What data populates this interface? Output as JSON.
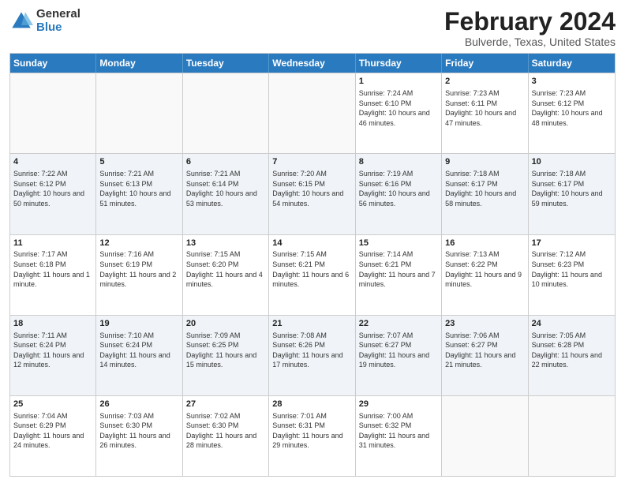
{
  "header": {
    "logo_general": "General",
    "logo_blue": "Blue",
    "title": "February 2024",
    "subtitle": "Bulverde, Texas, United States"
  },
  "days": [
    "Sunday",
    "Monday",
    "Tuesday",
    "Wednesday",
    "Thursday",
    "Friday",
    "Saturday"
  ],
  "rows": [
    [
      {
        "day": "",
        "sunrise": "",
        "sunset": "",
        "daylight": "",
        "empty": true
      },
      {
        "day": "",
        "sunrise": "",
        "sunset": "",
        "daylight": "",
        "empty": true
      },
      {
        "day": "",
        "sunrise": "",
        "sunset": "",
        "daylight": "",
        "empty": true
      },
      {
        "day": "",
        "sunrise": "",
        "sunset": "",
        "daylight": "",
        "empty": true
      },
      {
        "day": "1",
        "sunrise": "Sunrise: 7:24 AM",
        "sunset": "Sunset: 6:10 PM",
        "daylight": "Daylight: 10 hours and 46 minutes.",
        "empty": false
      },
      {
        "day": "2",
        "sunrise": "Sunrise: 7:23 AM",
        "sunset": "Sunset: 6:11 PM",
        "daylight": "Daylight: 10 hours and 47 minutes.",
        "empty": false
      },
      {
        "day": "3",
        "sunrise": "Sunrise: 7:23 AM",
        "sunset": "Sunset: 6:12 PM",
        "daylight": "Daylight: 10 hours and 48 minutes.",
        "empty": false
      }
    ],
    [
      {
        "day": "4",
        "sunrise": "Sunrise: 7:22 AM",
        "sunset": "Sunset: 6:12 PM",
        "daylight": "Daylight: 10 hours and 50 minutes.",
        "empty": false
      },
      {
        "day": "5",
        "sunrise": "Sunrise: 7:21 AM",
        "sunset": "Sunset: 6:13 PM",
        "daylight": "Daylight: 10 hours and 51 minutes.",
        "empty": false
      },
      {
        "day": "6",
        "sunrise": "Sunrise: 7:21 AM",
        "sunset": "Sunset: 6:14 PM",
        "daylight": "Daylight: 10 hours and 53 minutes.",
        "empty": false
      },
      {
        "day": "7",
        "sunrise": "Sunrise: 7:20 AM",
        "sunset": "Sunset: 6:15 PM",
        "daylight": "Daylight: 10 hours and 54 minutes.",
        "empty": false
      },
      {
        "day": "8",
        "sunrise": "Sunrise: 7:19 AM",
        "sunset": "Sunset: 6:16 PM",
        "daylight": "Daylight: 10 hours and 56 minutes.",
        "empty": false
      },
      {
        "day": "9",
        "sunrise": "Sunrise: 7:18 AM",
        "sunset": "Sunset: 6:17 PM",
        "daylight": "Daylight: 10 hours and 58 minutes.",
        "empty": false
      },
      {
        "day": "10",
        "sunrise": "Sunrise: 7:18 AM",
        "sunset": "Sunset: 6:17 PM",
        "daylight": "Daylight: 10 hours and 59 minutes.",
        "empty": false
      }
    ],
    [
      {
        "day": "11",
        "sunrise": "Sunrise: 7:17 AM",
        "sunset": "Sunset: 6:18 PM",
        "daylight": "Daylight: 11 hours and 1 minute.",
        "empty": false
      },
      {
        "day": "12",
        "sunrise": "Sunrise: 7:16 AM",
        "sunset": "Sunset: 6:19 PM",
        "daylight": "Daylight: 11 hours and 2 minutes.",
        "empty": false
      },
      {
        "day": "13",
        "sunrise": "Sunrise: 7:15 AM",
        "sunset": "Sunset: 6:20 PM",
        "daylight": "Daylight: 11 hours and 4 minutes.",
        "empty": false
      },
      {
        "day": "14",
        "sunrise": "Sunrise: 7:15 AM",
        "sunset": "Sunset: 6:21 PM",
        "daylight": "Daylight: 11 hours and 6 minutes.",
        "empty": false
      },
      {
        "day": "15",
        "sunrise": "Sunrise: 7:14 AM",
        "sunset": "Sunset: 6:21 PM",
        "daylight": "Daylight: 11 hours and 7 minutes.",
        "empty": false
      },
      {
        "day": "16",
        "sunrise": "Sunrise: 7:13 AM",
        "sunset": "Sunset: 6:22 PM",
        "daylight": "Daylight: 11 hours and 9 minutes.",
        "empty": false
      },
      {
        "day": "17",
        "sunrise": "Sunrise: 7:12 AM",
        "sunset": "Sunset: 6:23 PM",
        "daylight": "Daylight: 11 hours and 10 minutes.",
        "empty": false
      }
    ],
    [
      {
        "day": "18",
        "sunrise": "Sunrise: 7:11 AM",
        "sunset": "Sunset: 6:24 PM",
        "daylight": "Daylight: 11 hours and 12 minutes.",
        "empty": false
      },
      {
        "day": "19",
        "sunrise": "Sunrise: 7:10 AM",
        "sunset": "Sunset: 6:24 PM",
        "daylight": "Daylight: 11 hours and 14 minutes.",
        "empty": false
      },
      {
        "day": "20",
        "sunrise": "Sunrise: 7:09 AM",
        "sunset": "Sunset: 6:25 PM",
        "daylight": "Daylight: 11 hours and 15 minutes.",
        "empty": false
      },
      {
        "day": "21",
        "sunrise": "Sunrise: 7:08 AM",
        "sunset": "Sunset: 6:26 PM",
        "daylight": "Daylight: 11 hours and 17 minutes.",
        "empty": false
      },
      {
        "day": "22",
        "sunrise": "Sunrise: 7:07 AM",
        "sunset": "Sunset: 6:27 PM",
        "daylight": "Daylight: 11 hours and 19 minutes.",
        "empty": false
      },
      {
        "day": "23",
        "sunrise": "Sunrise: 7:06 AM",
        "sunset": "Sunset: 6:27 PM",
        "daylight": "Daylight: 11 hours and 21 minutes.",
        "empty": false
      },
      {
        "day": "24",
        "sunrise": "Sunrise: 7:05 AM",
        "sunset": "Sunset: 6:28 PM",
        "daylight": "Daylight: 11 hours and 22 minutes.",
        "empty": false
      }
    ],
    [
      {
        "day": "25",
        "sunrise": "Sunrise: 7:04 AM",
        "sunset": "Sunset: 6:29 PM",
        "daylight": "Daylight: 11 hours and 24 minutes.",
        "empty": false
      },
      {
        "day": "26",
        "sunrise": "Sunrise: 7:03 AM",
        "sunset": "Sunset: 6:30 PM",
        "daylight": "Daylight: 11 hours and 26 minutes.",
        "empty": false
      },
      {
        "day": "27",
        "sunrise": "Sunrise: 7:02 AM",
        "sunset": "Sunset: 6:30 PM",
        "daylight": "Daylight: 11 hours and 28 minutes.",
        "empty": false
      },
      {
        "day": "28",
        "sunrise": "Sunrise: 7:01 AM",
        "sunset": "Sunset: 6:31 PM",
        "daylight": "Daylight: 11 hours and 29 minutes.",
        "empty": false
      },
      {
        "day": "29",
        "sunrise": "Sunrise: 7:00 AM",
        "sunset": "Sunset: 6:32 PM",
        "daylight": "Daylight: 11 hours and 31 minutes.",
        "empty": false
      },
      {
        "day": "",
        "sunrise": "",
        "sunset": "",
        "daylight": "",
        "empty": true
      },
      {
        "day": "",
        "sunrise": "",
        "sunset": "",
        "daylight": "",
        "empty": true
      }
    ]
  ]
}
